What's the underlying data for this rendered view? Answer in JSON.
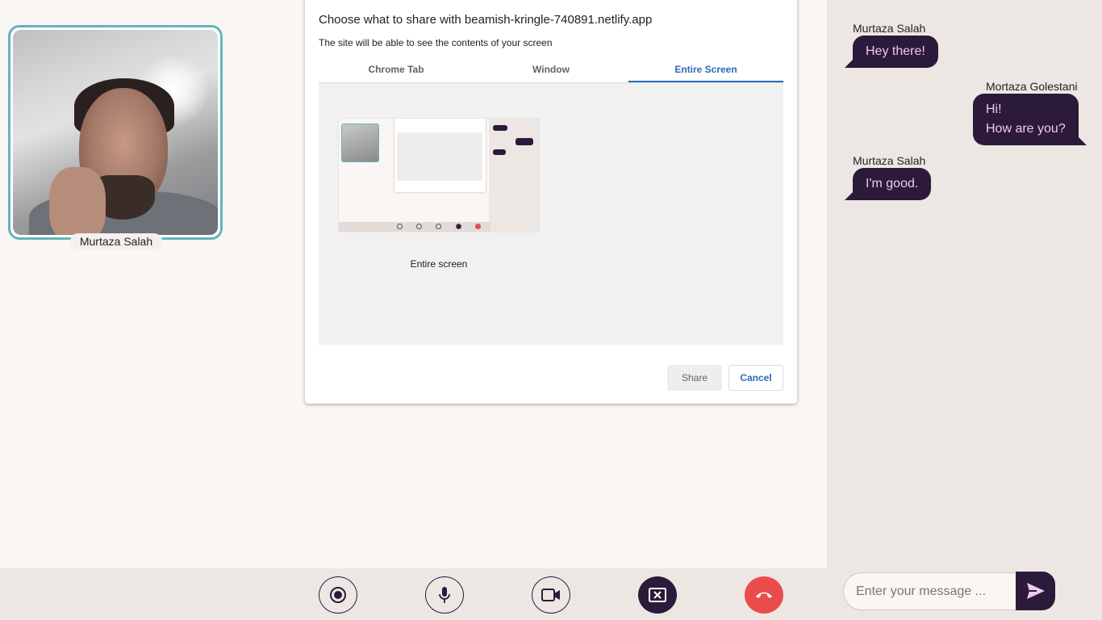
{
  "video": {
    "participant_name": "Murtaza Salah"
  },
  "share_dialog": {
    "title": "Choose what to share with beamish-kringle-740891.netlify.app",
    "subtitle": "The site will be able to see the contents of your screen",
    "tabs": [
      {
        "label": "Chrome Tab",
        "active": false
      },
      {
        "label": "Window",
        "active": false
      },
      {
        "label": "Entire Screen",
        "active": true
      }
    ],
    "source_label": "Entire screen",
    "share_label": "Share",
    "cancel_label": "Cancel"
  },
  "controls": [
    {
      "name": "record-button",
      "icon": "record-icon"
    },
    {
      "name": "mic-button",
      "icon": "mic-icon"
    },
    {
      "name": "camera-button",
      "icon": "video-camera-icon"
    },
    {
      "name": "stop-share-button",
      "icon": "stop-screen-share-icon"
    },
    {
      "name": "end-call-button",
      "icon": "phone-hangup-icon"
    }
  ],
  "chat": {
    "messages": [
      {
        "sender": "Murtaza Salah",
        "text": "Hey there!",
        "side": "left"
      },
      {
        "sender": "Mortaza Golestani",
        "lines": [
          "Hi!",
          "How are you?"
        ],
        "side": "right"
      },
      {
        "sender": "Murtaza Salah",
        "text": "I'm good.",
        "side": "left"
      }
    ],
    "input_placeholder": "Enter your message ...",
    "send_icon": "send-icon"
  },
  "colors": {
    "accent_dark": "#2c1a3a",
    "bubble_text": "#f0c8f0",
    "video_border": "#62b5bb",
    "hangup_red": "#ea4b4b",
    "link_blue": "#2a6bb8"
  }
}
